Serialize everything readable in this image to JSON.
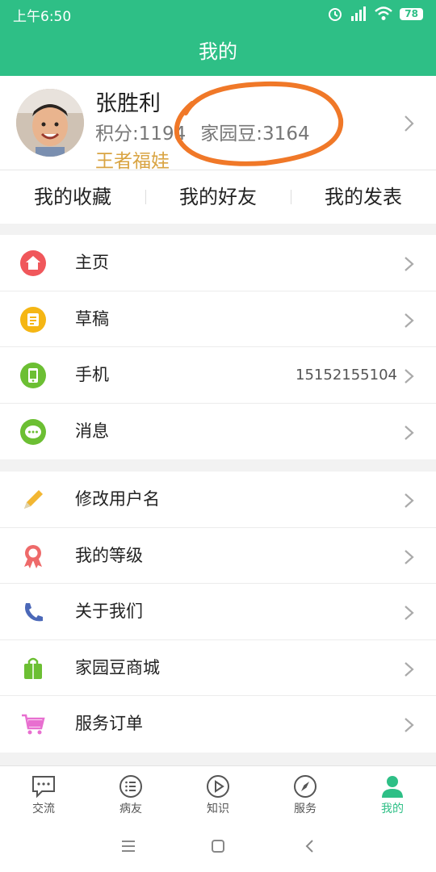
{
  "status": {
    "time": "上午6:50",
    "battery": "78"
  },
  "header": {
    "title": "我的"
  },
  "profile": {
    "name": "张胜利",
    "points": "积分:1194",
    "beans": "家园豆:3164",
    "title": "王者福娃"
  },
  "quick_links": [
    "我的收藏",
    "我的好友",
    "我的发表"
  ],
  "menu_group_1": [
    {
      "label": "主页",
      "icon": "home-icon",
      "color": "#f0575b"
    },
    {
      "label": "草稿",
      "icon": "draft-icon",
      "color": "#f5b614"
    },
    {
      "label": "手机",
      "icon": "phone-icon",
      "color": "#6cbf33",
      "value": "15152155104"
    },
    {
      "label": "消息",
      "icon": "message-icon",
      "color": "#6cbf33"
    }
  ],
  "menu_group_2": [
    {
      "label": "修改用户名",
      "icon": "pencil-icon",
      "color": "#f2b632"
    },
    {
      "label": "我的等级",
      "icon": "ribbon-icon",
      "color": "#ee6a6a"
    },
    {
      "label": "关于我们",
      "icon": "telephone-icon",
      "color": "#4b68b8"
    },
    {
      "label": "家园豆商城",
      "icon": "shopping-bag-icon",
      "color": "#6cbf33"
    },
    {
      "label": "服务订单",
      "icon": "cart-icon",
      "color": "#e86fd0"
    }
  ],
  "tabs": [
    {
      "label": "交流",
      "icon": "chat-icon"
    },
    {
      "label": "病友",
      "icon": "list-icon"
    },
    {
      "label": "知识",
      "icon": "play-icon"
    },
    {
      "label": "服务",
      "icon": "compass-icon"
    },
    {
      "label": "我的",
      "icon": "person-icon",
      "active": true
    }
  ],
  "colors": {
    "brand": "#2ebf86",
    "highlight_circle": "#f07828",
    "title_gold": "#d9a443"
  }
}
